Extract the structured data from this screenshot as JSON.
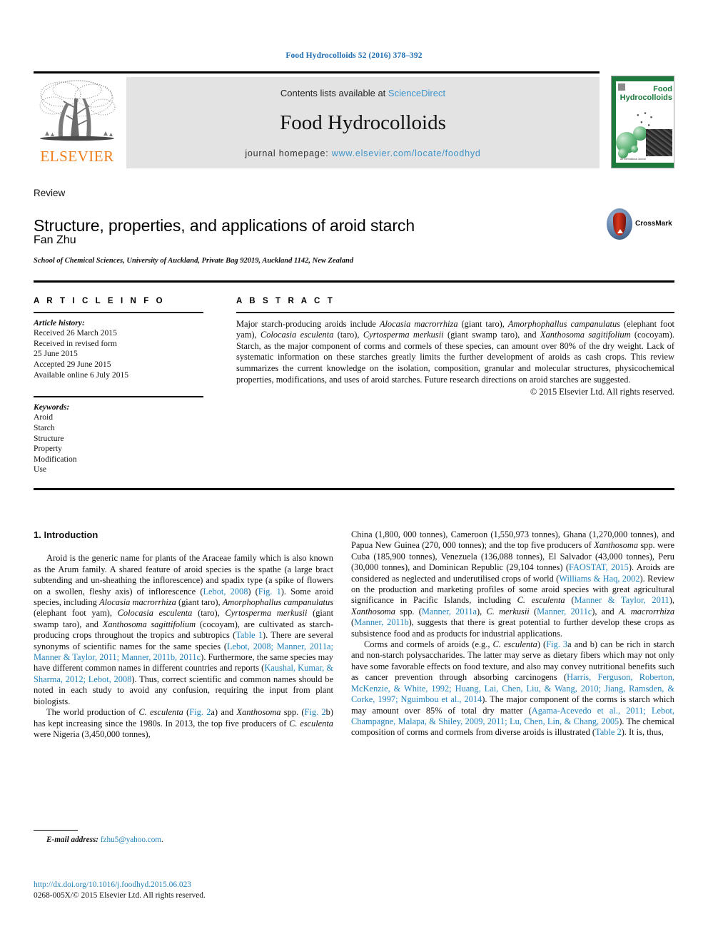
{
  "running_head": "Food Hydrocolloids 52 (2016) 378–392",
  "masthead": {
    "contents_prefix": "Contents lists available at ",
    "sciencedirect": "ScienceDirect",
    "journal_title": "Food Hydrocolloids",
    "homepage_label": "journal homepage: ",
    "homepage_url": "www.elsevier.com/locate/foodhyd",
    "publisher_wordmark": "ELSEVIER",
    "publisher_logo_icon": "elsevier-tree-icon",
    "cover_title_line1": "Food",
    "cover_title_line2": "Hydrocolloids",
    "cover_caption": "An International Journal",
    "accent_link_color": "#3c93c9",
    "band_color": "#e3e3e3",
    "cover_green": "#1e7a3c",
    "elsevier_orange": "#ef7d1a"
  },
  "article": {
    "doctype": "Review",
    "title": "Structure, properties, and applications of aroid starch",
    "authors": "Fan Zhu",
    "affiliation": "School of Chemical Sciences, University of Auckland, Private Bag 92019, Auckland 1142, New Zealand",
    "crossmark_label": "CrossMark",
    "crossmark_icon": "crossmark-badge-icon"
  },
  "info": {
    "heading": "A R T I C L E   I N F O",
    "history_label": "Article history:",
    "history": [
      "Received 26 March 2015",
      "Received in revised form",
      "25 June 2015",
      "Accepted 29 June 2015",
      "Available online 6 July 2015"
    ],
    "keywords_label": "Keywords:",
    "keywords": [
      "Aroid",
      "Starch",
      "Structure",
      "Property",
      "Modification",
      "Use"
    ]
  },
  "abstract": {
    "heading": "A B S T R A C T",
    "copyright": "© 2015 Elsevier Ltd. All rights reserved."
  },
  "body": {
    "section_heading": "1. Introduction"
  },
  "footnote": {
    "email_label": "E-mail address:",
    "email": "fzhu5@yahoo.com",
    "email_trailing": "."
  },
  "imprint": {
    "doi": "http://dx.doi.org/10.1016/j.foodhyd.2015.06.023",
    "issn_line": "0268-005X/© 2015 Elsevier Ltd. All rights reserved."
  },
  "colors": {
    "link": "#1f7fb8",
    "running_head": "#1f6fb4",
    "text": "#111111"
  }
}
